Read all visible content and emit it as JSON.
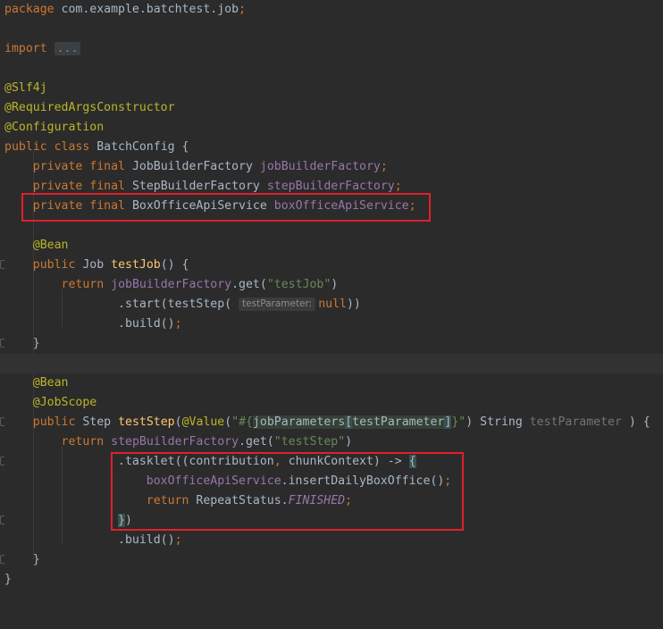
{
  "editor": {
    "package_line": {
      "keyword": "package",
      "name": "com.example.batchtest.job",
      "semi": ";"
    },
    "import_line": {
      "keyword": "import",
      "fold": "..."
    },
    "annotations": [
      "@Slf4j",
      "@RequiredArgsConstructor",
      "@Configuration"
    ],
    "class_decl": {
      "mods": "public class",
      "name": "BatchConfig",
      "brace": "{"
    },
    "fields": [
      {
        "mods": "private final",
        "type": "JobBuilderFactory",
        "name": "jobBuilderFactory",
        "semi": ";"
      },
      {
        "mods": "private final",
        "type": "StepBuilderFactory",
        "name": "stepBuilderFactory",
        "semi": ";"
      },
      {
        "mods": "private final",
        "type": "BoxOfficeApiService",
        "name": "boxOfficeApiService",
        "semi": ";"
      }
    ],
    "job_method": {
      "annotation": "@Bean",
      "mods": "public",
      "type": "Job",
      "name": "testJob",
      "sig_rest": "() {",
      "ret_kw": "return",
      "factory": "jobBuilderFactory",
      "get_call": ".get(",
      "job_name": "\"testJob\"",
      "get_close": ")",
      "start_call": ".start(testStep(",
      "hint_label": "testParameter:",
      "null_kw": "null",
      "start_close": "))",
      "build_call": ".build()",
      "build_semi": ";",
      "close_brace": "}"
    },
    "step_method": {
      "annotation1": "@Bean",
      "annotation2": "@JobScope",
      "mods": "public",
      "type": "Step",
      "name": "testStep",
      "param_open": "(",
      "value_ann": "@Value",
      "value_open": "(",
      "str_open": "\"#{",
      "expr_obj": "jobParameters",
      "bracket_open": "[",
      "expr_key": "testParameter",
      "bracket_close": "]",
      "str_close": "}\"",
      "value_close": ")",
      "param_type": "String",
      "param_name": "testParameter",
      "sig_close": ") {",
      "ret_kw": "return",
      "factory": "stepBuilderFactory",
      "get_call": ".get(",
      "step_name": "\"testStep\"",
      "get_close": ")",
      "tasklet_call": ".tasklet(",
      "lambda_open": "(contribution",
      "comma": ",",
      "lambda_rest": " chunkContext) -> ",
      "lambda_brace": "{",
      "service_ref": "boxOfficeApiService",
      "service_call": ".insertDailyBoxOffice()",
      "service_semi": ";",
      "ret2_kw": "return",
      "repeat_cls": "RepeatStatus.",
      "finished": "FINISHED",
      "finished_semi": ";",
      "lambda_close_brace": "}",
      "lambda_close_paren": ")",
      "build_call": ".build()",
      "build_semi": ";",
      "close_brace": "}"
    },
    "class_close": "}"
  },
  "colors": {
    "background": "#2b2b2b",
    "keyword": "#cc7832",
    "annotation": "#bbb529",
    "field": "#9876aa",
    "method": "#ffc66d",
    "string": "#6a8759",
    "default": "#a9b7c6",
    "highlight_box": "#e0202a"
  }
}
